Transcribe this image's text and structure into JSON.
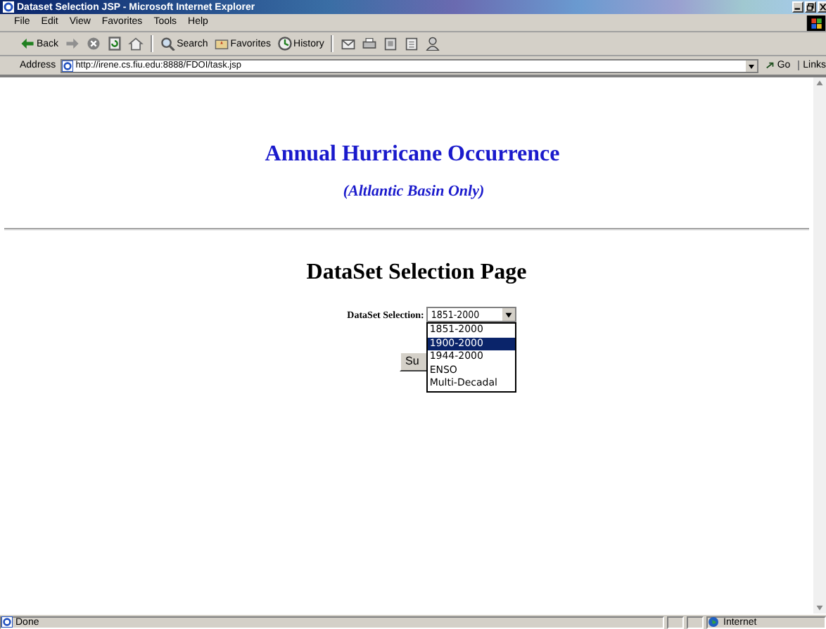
{
  "window": {
    "title": "Dataset Selection JSP - Microsoft Internet Explorer"
  },
  "menu": [
    "File",
    "Edit",
    "View",
    "Favorites",
    "Tools",
    "Help"
  ],
  "toolbar": [
    {
      "kind": "back",
      "label": "Back"
    },
    {
      "kind": "forward"
    },
    {
      "kind": "stop"
    },
    {
      "kind": "refresh"
    },
    {
      "kind": "home"
    },
    {
      "kind": "search",
      "label": "Search"
    },
    {
      "kind": "favorites",
      "label": "Favorites"
    },
    {
      "kind": "history",
      "label": "History"
    },
    {
      "kind": "mail"
    },
    {
      "kind": "print"
    },
    {
      "kind": "edit"
    },
    {
      "kind": "discuss"
    },
    {
      "kind": "messenger"
    }
  ],
  "address": {
    "label": "Address",
    "url": "http://irene.cs.fiu.edu:8888/FDOI/task.jsp",
    "go": "Go",
    "links": "Links"
  },
  "page": {
    "heading": "Annual Hurricane Occurrence",
    "subheading": "(Altlantic Basin Only)",
    "section_title": "DataSet Selection Page",
    "field_label": "DataSet Selection:",
    "select_value": "1851-2000",
    "options": [
      {
        "label": "1851-2000",
        "selected": false
      },
      {
        "label": "1900-2000",
        "selected": true
      },
      {
        "label": "1944-2000",
        "selected": false
      },
      {
        "label": "ENSO",
        "selected": false
      },
      {
        "label": "Multi-Decadal",
        "selected": false
      }
    ],
    "submit_label": "Su"
  },
  "status_bar": {
    "text": "Done",
    "zone": "Internet"
  }
}
